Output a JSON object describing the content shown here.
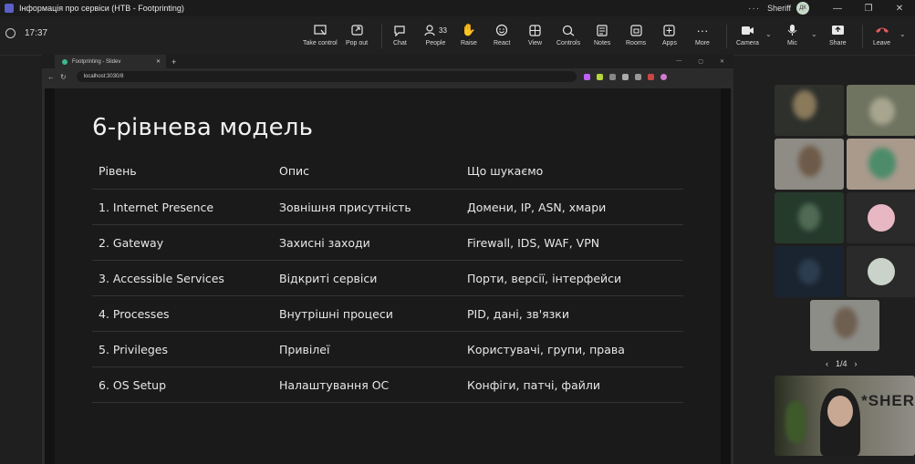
{
  "window": {
    "title": "Інформація про сервіси (НТВ - Footprinting)",
    "user_name": "Sheriff",
    "user_initials": "ДК",
    "more": "···"
  },
  "toolbar": {
    "timer": "17:37",
    "buttons": {
      "take_control": "Take control",
      "pop_out": "Pop out",
      "chat": "Chat",
      "people": "People",
      "people_count": "33",
      "raise": "Raise",
      "react": "React",
      "view": "View",
      "controls": "Controls",
      "notes": "Notes",
      "rooms": "Rooms",
      "apps": "Apps",
      "more": "More",
      "camera": "Camera",
      "mic": "Mic",
      "share": "Share",
      "leave": "Leave"
    }
  },
  "browser": {
    "tab_title": "Footprinting - Slidev",
    "url": "localhost:3030/8"
  },
  "slide": {
    "title": "6-рівнева модель",
    "headers": [
      "Рівень",
      "Опис",
      "Що шукаємо"
    ],
    "rows": [
      [
        "1. Internet Presence",
        "Зовнішня присутність",
        "Домени, IP, ASN, хмари"
      ],
      [
        "2. Gateway",
        "Захисні заходи",
        "Firewall, IDS, WAF, VPN"
      ],
      [
        "3. Accessible Services",
        "Відкриті сервіси",
        "Порти, версії, інтерфейси"
      ],
      [
        "4. Processes",
        "Внутрішні процеси",
        "PID, дані, зв'язки"
      ],
      [
        "5. Privileges",
        "Привілеї",
        "Користувачі, групи, права"
      ],
      [
        "6. OS Setup",
        "Налаштування ОС",
        "Конфіги, патчі, файли"
      ]
    ]
  },
  "participants": {
    "pager": "1/4",
    "selfview_brand": "*SHER"
  },
  "colors": {
    "teams_purple": "#5b5fc7",
    "leave_red": "#e05a5a",
    "slide_bg": "#1a1a1a"
  }
}
